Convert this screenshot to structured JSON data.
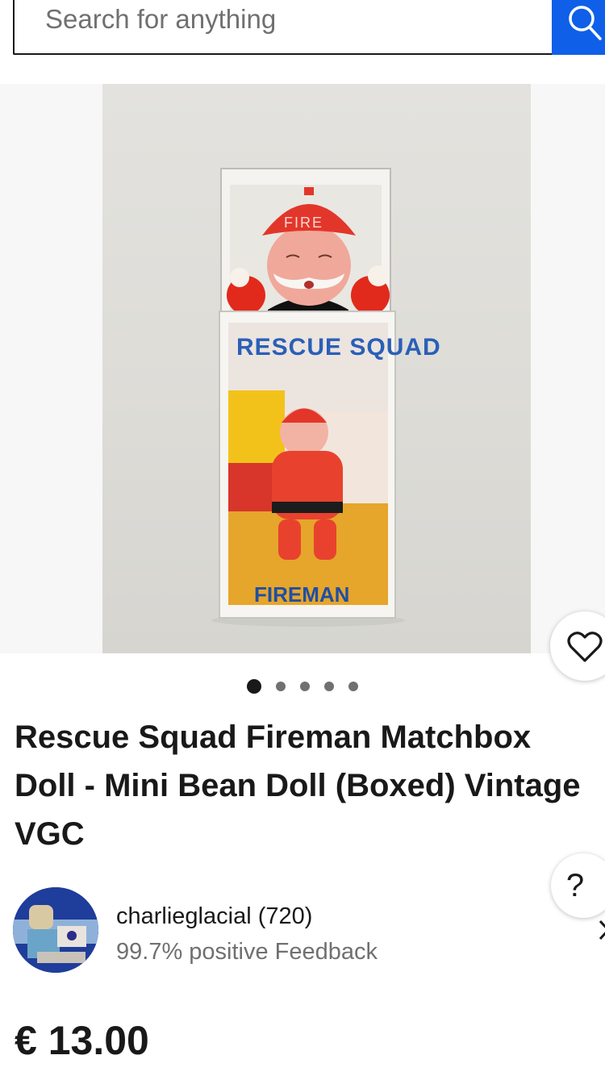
{
  "search": {
    "placeholder": "Search for anything"
  },
  "gallery": {
    "box_text_top": "RESCUE SQUAD",
    "box_text_bottom": "FIREMAN",
    "helmet_text": "FIRE",
    "dot_count": 5,
    "active_dot": 1
  },
  "listing": {
    "title": "Rescue Squad Fireman Matchbox Doll - Mini Bean Doll (Boxed) Vintage VGC",
    "price": "€ 13.00"
  },
  "seller": {
    "name": "charlieglacial (720)",
    "feedback": "99.7% positive Feedback"
  },
  "help": {
    "label": "?"
  },
  "icons": {
    "search": "search-icon",
    "favorite": "heart-icon",
    "chevron": "chevron-right-icon"
  },
  "colors": {
    "accent": "#0f5fe8",
    "text": "#191919",
    "muted": "#707070"
  }
}
